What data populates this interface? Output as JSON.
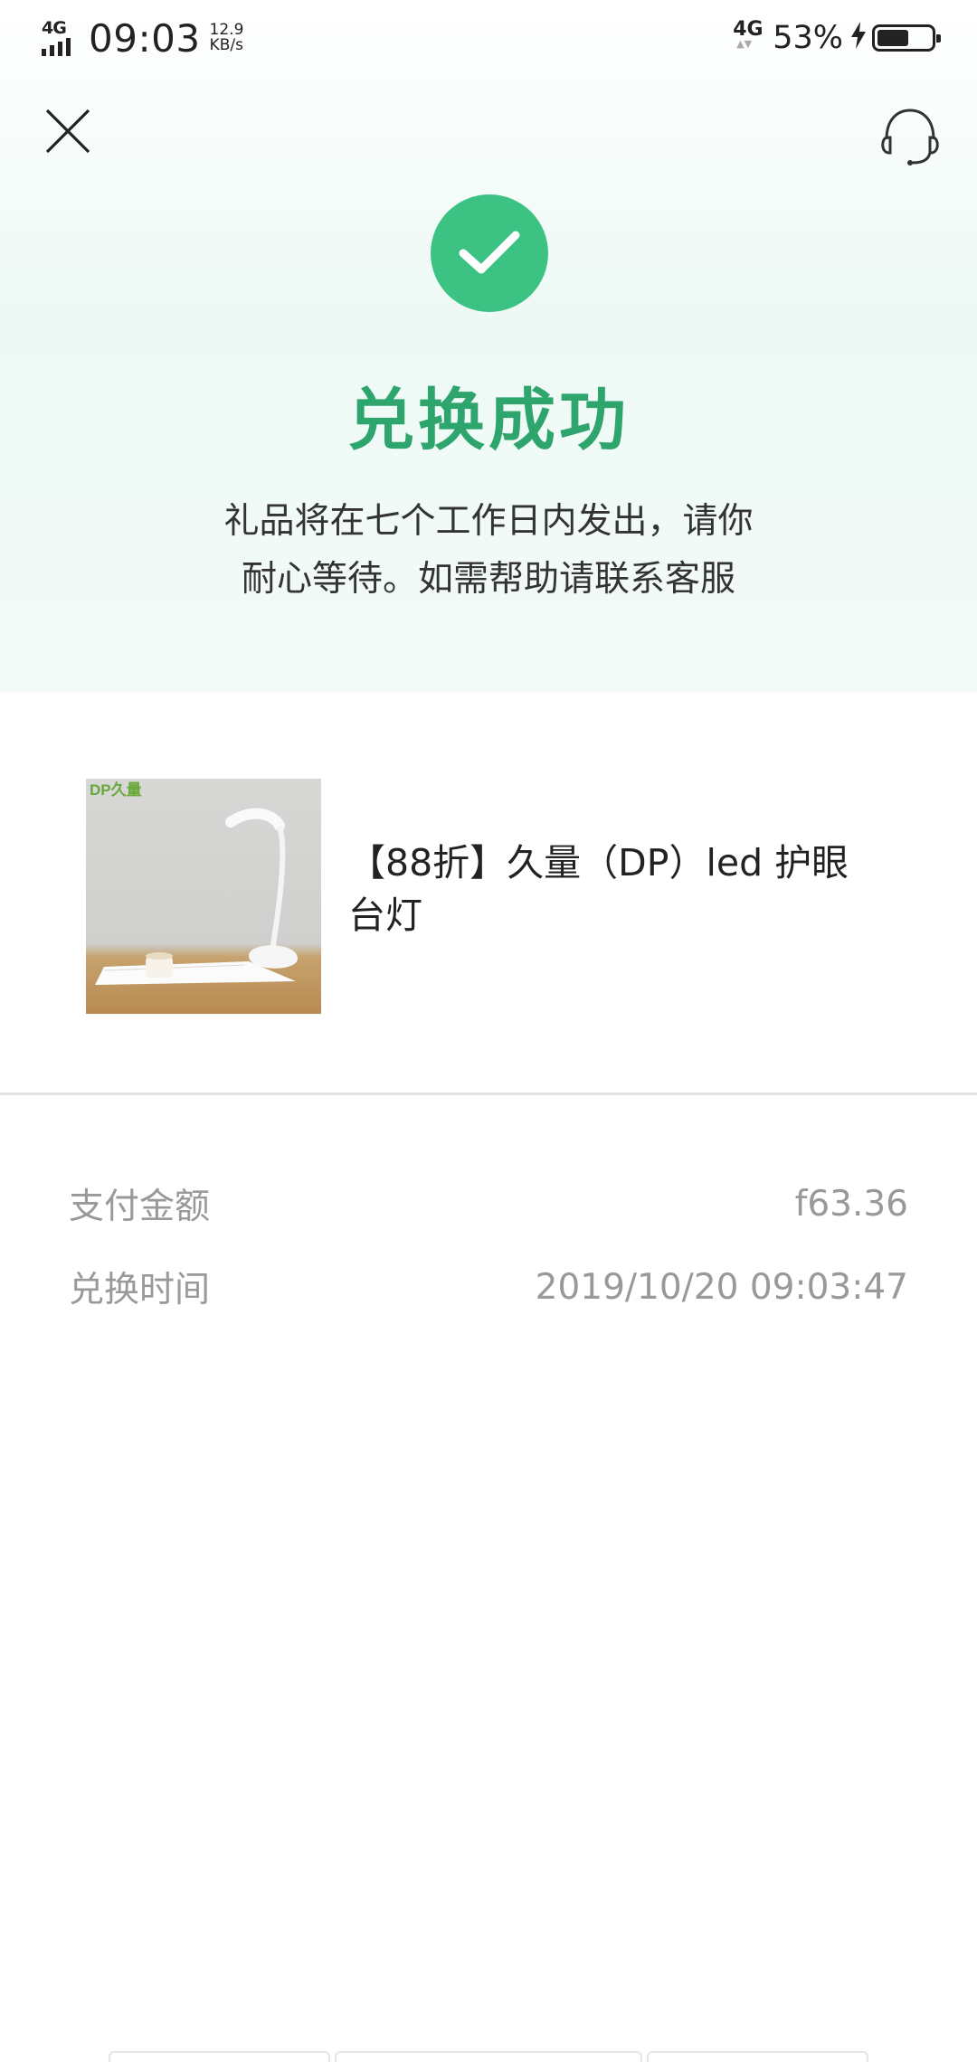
{
  "status_bar": {
    "network_left": "4G",
    "time": "09:03",
    "speed_value": "12.9",
    "speed_unit": "KB/s",
    "network_right": "4G",
    "battery_percent": "53%"
  },
  "header": {
    "close_icon": "close-icon",
    "service_icon": "headset-icon"
  },
  "result": {
    "title": "兑换成功",
    "desc_line1": "礼品将在七个工作日内发出，请你",
    "desc_line2": "耐心等待。如需帮助请联系客服"
  },
  "product": {
    "name_line1": "【88折】久量（DP）led 护眼",
    "name_line2": "台灯",
    "image_brand": "DP久量"
  },
  "details": {
    "amount_label": "支付金额",
    "amount_value": "f63.36",
    "time_label": "兑换时间",
    "time_value": "2019/10/20 09:03:47"
  },
  "colors": {
    "accent": "#3cc384",
    "title": "#2fa56e"
  }
}
